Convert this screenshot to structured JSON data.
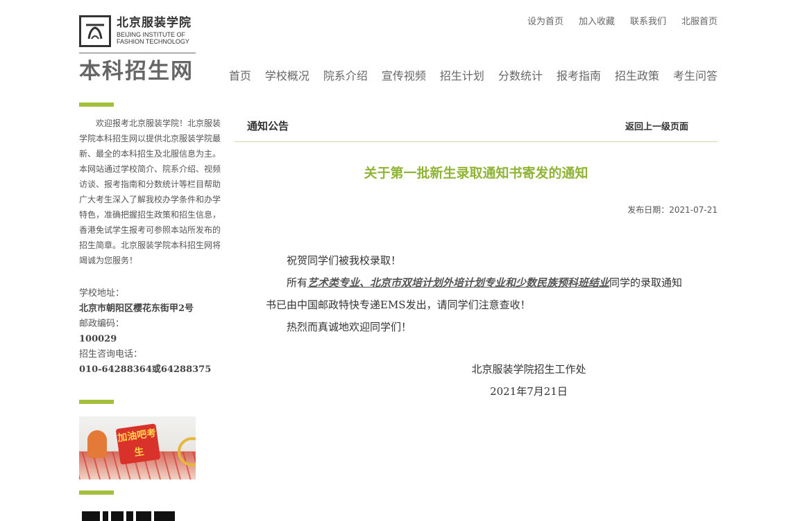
{
  "logo": {
    "cn": "北京服装学院",
    "en_line1": "BEIJING INSTITUTE OF",
    "en_line2": "FASHION TECHNOLOGY"
  },
  "site_name": "本科招生网",
  "top_links": [
    "设为首页",
    "加入收藏",
    "联系我们",
    "北服首页"
  ],
  "nav": [
    "首页",
    "学校概况",
    "院系介绍",
    "宣传视频",
    "招生计划",
    "分数统计",
    "报考指南",
    "招生政策",
    "考生问答"
  ],
  "sidebar": {
    "intro": "欢迎报考北京服装学院！北京服装学院本科招生网以提供北京服装学院最新、最全的本科招生及北服信息为主。本网站通过学校简介、院系介绍、视频访谈、报考指南和分数统计等栏目帮助广大考生深入了解我校办学条件和办学特色，准确把握招生政策和招生信息，香港免试学生报考可参照本站所发布的招生简章。北京服装学院本科招生网将竭诚为您服务！",
    "address_label": "学校地址：",
    "address": "北京市朝阳区樱花东街甲2号",
    "postcode_label": "邮政编码：",
    "postcode": "100029",
    "phone_label": "招生咨询电话：",
    "phone": "010-64288364或64288375",
    "promo_text": "加油吧考生"
  },
  "panel": {
    "title": "通知公告",
    "back": "返回上一级页面"
  },
  "article": {
    "title": "关于第一批新生录取通知书寄发的通知",
    "date_label": "发布日期：",
    "date": "2021-07-21",
    "p1": "祝贺同学们被我校录取！",
    "p2_pre": "所有",
    "p2_highlight": "艺术类专业、北京市双培计划外培计划专业和少数民族预科班结业",
    "p2_post": "同学的录取通知书已由中国邮政特快专递EMS发出，请同学们注意查收！",
    "p3": "热烈而真诚地欢迎同学们！",
    "sign_org": "北京服装学院招生工作处",
    "sign_date": "2021年7月21日"
  },
  "colors": {
    "accent": "#a2c03c",
    "title_green": "#8fb436"
  }
}
